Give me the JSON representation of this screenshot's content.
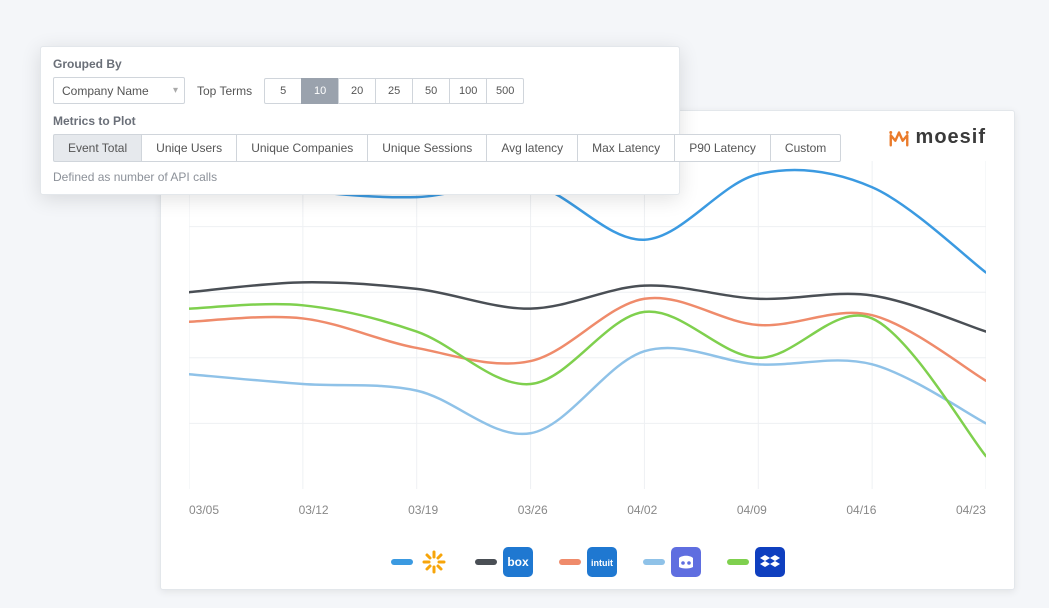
{
  "brand": {
    "name": "moesif",
    "accent_color": "#ea7b2b"
  },
  "filters": {
    "grouped_by_label": "Grouped By",
    "group_select_value": "Company Name",
    "top_terms_label": "Top Terms",
    "top_terms_options": [
      "5",
      "10",
      "20",
      "25",
      "50",
      "100",
      "500"
    ],
    "top_terms_selected": "10",
    "metrics_label": "Metrics to Plot",
    "metrics_options": [
      "Event Total",
      "Uniqe Users",
      "Unique Companies",
      "Unique Sessions",
      "Avg latency",
      "Max Latency",
      "P90 Latency",
      "Custom"
    ],
    "metrics_selected": "Event Total",
    "metrics_footnote": "Defined as number of API calls"
  },
  "legend": {
    "items": [
      {
        "name": "Walmart",
        "color": "#3b9ae1",
        "logo_bg": "#ffffff"
      },
      {
        "name": "Box",
        "color": "#4a4f55",
        "logo_bg": "#1f78d1"
      },
      {
        "name": "Intuit",
        "color": "#ef8b6b",
        "logo_bg": "#1f78d1"
      },
      {
        "name": "Discord",
        "color": "#8fc2e8",
        "logo_bg": "#5f6ee0"
      },
      {
        "name": "Dropbox",
        "color": "#7fd04e",
        "logo_bg": "#0f3fbf"
      }
    ]
  },
  "chart_data": {
    "type": "line",
    "title": "",
    "xlabel": "",
    "ylabel": "",
    "ylim": [
      0,
      100
    ],
    "x": [
      "03/05",
      "03/12",
      "03/19",
      "03/26",
      "04/02",
      "04/09",
      "04/16",
      "04/23"
    ],
    "series": [
      {
        "name": "Walmart",
        "color": "#3b9ae1",
        "values": [
          97,
          91,
          89,
          93,
          76,
          96,
          92,
          66
        ]
      },
      {
        "name": "Box",
        "color": "#4a4f55",
        "values": [
          60,
          63,
          61,
          55,
          62,
          58,
          59,
          48
        ]
      },
      {
        "name": "Intuit",
        "color": "#ef8b6b",
        "values": [
          51,
          52,
          43,
          39,
          58,
          50,
          53,
          33
        ]
      },
      {
        "name": "Discord",
        "color": "#8fc2e8",
        "values": [
          35,
          32,
          30,
          17,
          42,
          38,
          38,
          20
        ]
      },
      {
        "name": "Dropbox",
        "color": "#7fd04e",
        "values": [
          55,
          56,
          48,
          32,
          54,
          40,
          52,
          10
        ]
      }
    ]
  }
}
